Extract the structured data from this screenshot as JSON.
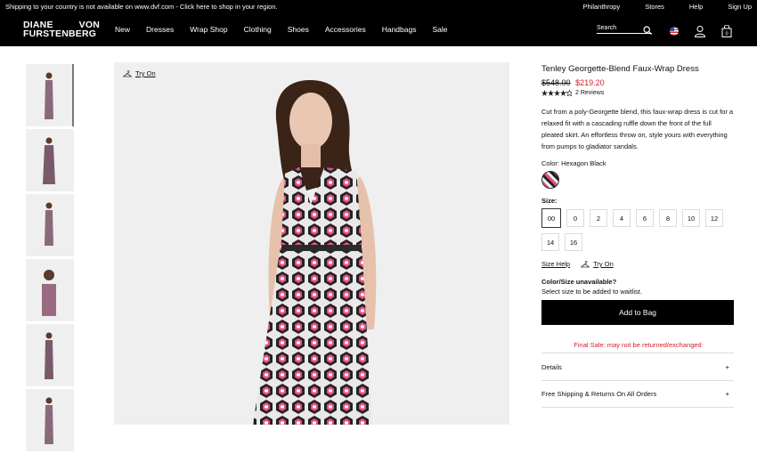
{
  "topbar": {
    "shipping_text": "Shipping to your country is not available on www.dvf.com - Click here to shop in your region.",
    "links": [
      "Philanthropy",
      "Stores",
      "Help",
      "Sign Up"
    ]
  },
  "header": {
    "logo_line1_left": "DIANE",
    "logo_line1_right": "VON",
    "logo_line2": "FURSTENBERG",
    "menu": [
      "New",
      "Dresses",
      "Wrap Shop",
      "Clothing",
      "Shoes",
      "Accessories",
      "Handbags",
      "Sale"
    ],
    "search_placeholder": "Search"
  },
  "gallery": {
    "try_on_label": "Try On"
  },
  "product": {
    "title": "Tenley Georgette-Blend Faux-Wrap Dress",
    "old_price": "$548.00",
    "new_price": "$219.20",
    "rating": 4.5,
    "reviews_label": "2 Reviews",
    "description": "Cut from a poly-Georgette blend, this faux-wrap dress is cut for a relaxed fit with a cascading ruffle down the front of the full pleated skirt. An effortless throw on, style yours with everything from pumps to gladiator sandals.",
    "color_label": "Color: Hexagon Black",
    "size_label": "Size:",
    "sizes": [
      "00",
      "0",
      "2",
      "4",
      "6",
      "8",
      "10",
      "12",
      "14",
      "16"
    ],
    "selected_size": "00",
    "size_help_label": "Size Help",
    "try_on_label": "Try On",
    "unavailable_title": "Color/Size unavailable?",
    "unavailable_text": "Select size to be added to waitlist.",
    "add_to_bag_label": "Add to Bag",
    "final_sale_text": "Final Sale: may not be returned/exchanged",
    "accordions": [
      "Details",
      "Free Shipping & Returns On All Orders"
    ]
  },
  "colors": {
    "accent_red": "#d3202f",
    "black": "#000000",
    "image_bg": "#efefef"
  }
}
